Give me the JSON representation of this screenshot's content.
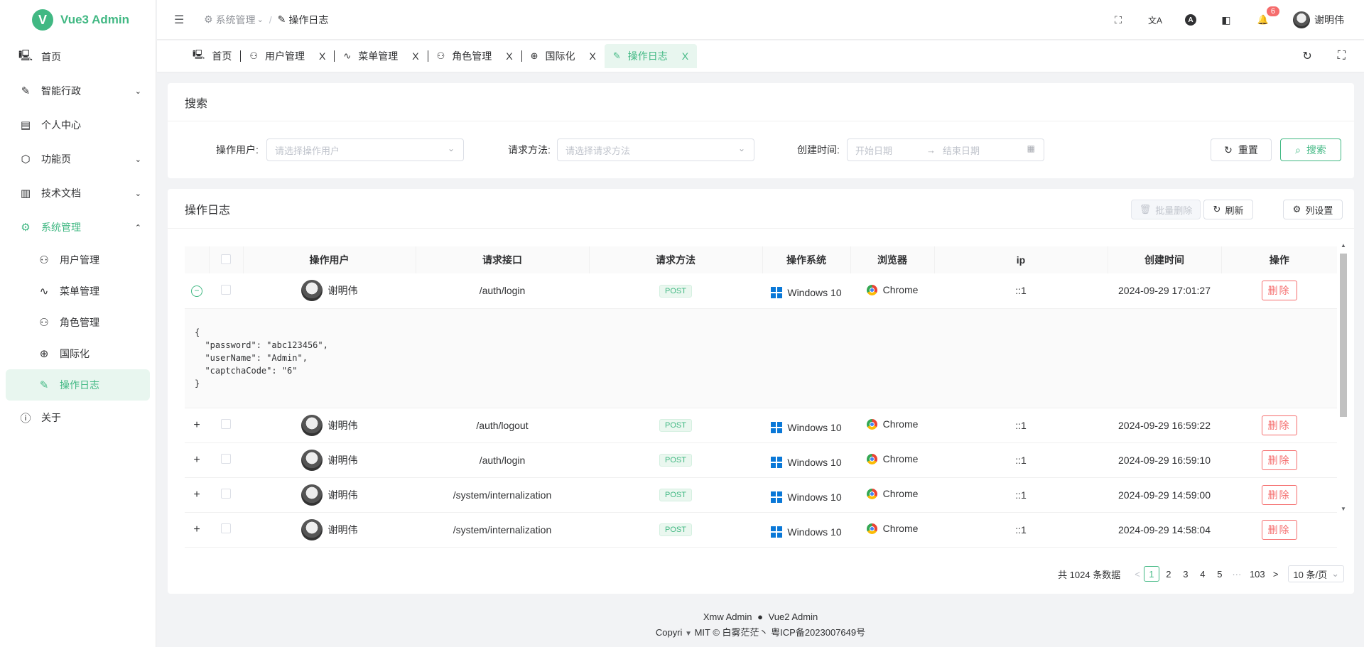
{
  "app": {
    "title": "Vue3 Admin",
    "logo_letter": "V"
  },
  "sidebar": {
    "items": [
      {
        "icon": "🖳",
        "label": "首页"
      },
      {
        "icon": "✎",
        "label": "智能行政",
        "arrow": "⌄"
      },
      {
        "icon": "▤",
        "label": "个人中心"
      },
      {
        "icon": "⬡",
        "label": "功能页",
        "arrow": "⌄"
      },
      {
        "icon": "▥",
        "label": "技术文档",
        "arrow": "⌄"
      },
      {
        "icon": "⚙",
        "label": "系统管理",
        "arrow": "⌃"
      }
    ],
    "sub_items": [
      {
        "icon": "⚇",
        "label": "用户管理"
      },
      {
        "icon": "∿",
        "label": "菜单管理"
      },
      {
        "icon": "⚇",
        "label": "角色管理"
      },
      {
        "icon": "⊕",
        "label": "国际化"
      },
      {
        "icon": "✎",
        "label": "操作日志"
      }
    ],
    "about": {
      "icon": "ⓘ",
      "label": "关于"
    }
  },
  "header": {
    "collapse_icon": "☰",
    "breadcrumb_parent_icon": "⚙",
    "breadcrumb_parent": "系统管理",
    "breadcrumb_arrow": "⌄",
    "breadcrumb_sep": "/",
    "breadcrumb_current_icon": "✎",
    "breadcrumb_current": "操作日志",
    "fullscreen_icon": "⛶",
    "translate_icon": "文A",
    "theme_letter": "A",
    "layout_icon": "◧",
    "bell_icon": "🔔",
    "notification_count": "6",
    "user_name": "谢明伟"
  },
  "tabs": [
    {
      "icon": "🖳",
      "label": "首页"
    },
    {
      "icon": "⚇",
      "label": "用户管理",
      "close": "X"
    },
    {
      "icon": "∿",
      "label": "菜单管理",
      "close": "X"
    },
    {
      "icon": "⚇",
      "label": "角色管理",
      "close": "X"
    },
    {
      "icon": "⊕",
      "label": "国际化",
      "close": "X"
    },
    {
      "icon": "✎",
      "label": "操作日志",
      "close": "X"
    }
  ],
  "tabs_tools": {
    "refresh_icon": "↻",
    "fullscreen_icon": "⛶"
  },
  "search": {
    "title": "搜索",
    "user_label": "操作用户:",
    "user_placeholder": "请选择操作用户",
    "method_label": "请求方法:",
    "method_placeholder": "请选择请求方法",
    "time_label": "创建时间:",
    "start_placeholder": "开始日期",
    "range_sep": "→",
    "end_placeholder": "结束日期",
    "reset_label": "重置",
    "search_label": "搜索"
  },
  "table": {
    "title": "操作日志",
    "batch_delete": "批量删除",
    "refresh": "刷新",
    "columns_setting": "列设置",
    "columns": [
      "",
      "",
      "操作用户",
      "请求接口",
      "请求方法",
      "操作系统",
      "浏览器",
      "ip",
      "创建时间",
      "操作"
    ],
    "expanded_json": "{\n  \"password\": \"abc123456\",\n  \"userName\": \"Admin\",\n  \"captchaCode\": \"6\"\n}",
    "rows": [
      {
        "expand": "−",
        "user": "谢明伟",
        "api": "/auth/login",
        "method": "POST",
        "os": "Windows 10",
        "browser": "Chrome",
        "ip": "::1",
        "time": "2024-09-29 17:01:27",
        "action": "删除"
      },
      {
        "expand": "+",
        "user": "谢明伟",
        "api": "/auth/logout",
        "method": "POST",
        "os": "Windows 10",
        "browser": "Chrome",
        "ip": "::1",
        "time": "2024-09-29 16:59:22",
        "action": "删除"
      },
      {
        "expand": "+",
        "user": "谢明伟",
        "api": "/auth/login",
        "method": "POST",
        "os": "Windows 10",
        "browser": "Chrome",
        "ip": "::1",
        "time": "2024-09-29 16:59:10",
        "action": "删除"
      },
      {
        "expand": "+",
        "user": "谢明伟",
        "api": "/system/internalization",
        "method": "POST",
        "os": "Windows 10",
        "browser": "Chrome",
        "ip": "::1",
        "time": "2024-09-29 14:59:00",
        "action": "删除"
      },
      {
        "expand": "+",
        "user": "谢明伟",
        "api": "/system/internalization",
        "method": "POST",
        "os": "Windows 10",
        "browser": "Chrome",
        "ip": "::1",
        "time": "2024-09-29 14:58:04",
        "action": "删除"
      }
    ]
  },
  "pagination": {
    "total_text": "共 1024 条数据",
    "prev": "<",
    "pages": [
      "1",
      "2",
      "3",
      "4",
      "5"
    ],
    "ellipsis": "···",
    "last_page": "103",
    "next": ">",
    "page_size": "10 条/页",
    "page_size_arrow": "⌄"
  },
  "footer": {
    "line1_left": "Xmw Admin",
    "github_icon": "●",
    "line1_right": "Vue2 Admin",
    "line2_prefix": "Copyri",
    "line2_rest": "MIT © 白雾茫茫丶 粤ICP备2023007649号",
    "scroll_arrow": "▼"
  },
  "colors": {
    "accent": "#41b883",
    "danger": "#f56c6c",
    "windows_blue": "#0a78d7"
  }
}
